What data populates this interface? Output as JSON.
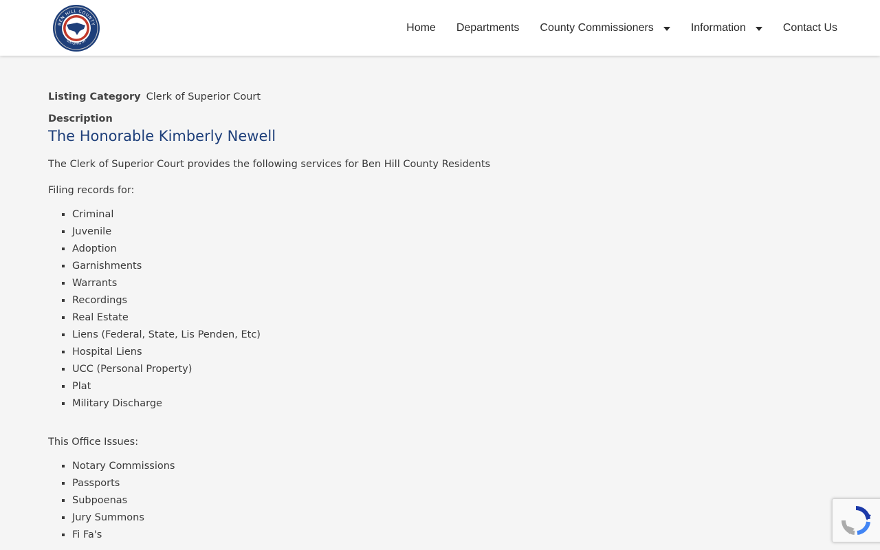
{
  "site": {
    "logo_name": "ben-hill-county-seal-icon",
    "logo_text_top": "BEN HILL COUNTY",
    "logo_text_bottom": "GEORGIA"
  },
  "nav": {
    "items": [
      {
        "label": "Home",
        "has_dropdown": false
      },
      {
        "label": "Departments",
        "has_dropdown": false
      },
      {
        "label": "County Commissioners",
        "has_dropdown": true
      },
      {
        "label": "Information",
        "has_dropdown": true
      },
      {
        "label": "Contact Us",
        "has_dropdown": false
      }
    ]
  },
  "listing": {
    "category_label": "Listing Category",
    "category_value": "Clerk of Superior Court",
    "description_label": "Description",
    "title": "The Honorable Kimberly Newell",
    "intro": "The Clerk of Superior Court provides the following services for Ben Hill County Residents",
    "filing_heading": "Filing records for:",
    "filing_items": [
      "Criminal",
      "Juvenile",
      "Adoption",
      "Garnishments",
      "Warrants",
      "Recordings",
      "Real Estate",
      "Liens (Federal, State, Lis Penden, Etc)",
      "Hospital Liens",
      "UCC (Personal Property)",
      "Plat",
      "Military Discharge"
    ],
    "issues_heading": "This Office Issues:",
    "issues_items": [
      "Notary Commissions",
      "Passports",
      "Subpoenas",
      "Jury Summons",
      "Fi Fa's"
    ]
  },
  "colors": {
    "title_blue": "#1e3f7a",
    "page_bg": "#f5f5f5",
    "header_bg": "#ffffff",
    "seal_blue": "#1e3f7a",
    "seal_red": "#c0392b"
  },
  "recaptcha": {
    "icon": "recaptcha-icon"
  }
}
